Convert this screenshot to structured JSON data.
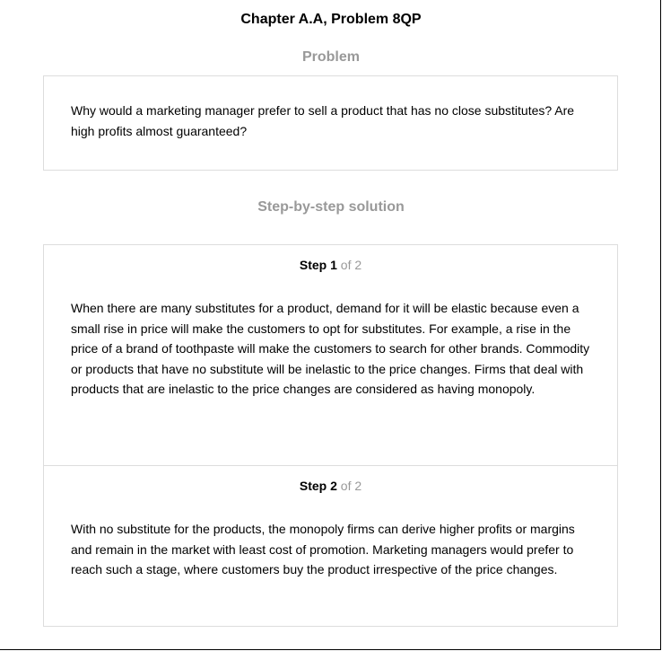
{
  "header": {
    "title": "Chapter A.A, Problem 8QP"
  },
  "problem": {
    "heading": "Problem",
    "text": "Why would a marketing manager prefer to sell a product that has no close substitutes? Are high profits almost guaranteed?"
  },
  "solution": {
    "heading": "Step-by-step solution",
    "step_word": "Step",
    "steps": [
      {
        "number": "1",
        "of_label": "of 2",
        "text": "When there are many substitutes for a product, demand for it will be elastic because even a small rise in price will make the customers to opt for substitutes. For example, a rise in the price of a brand of toothpaste will make the customers to search for other brands. Commodity or products that have no substitute will be inelastic to the price changes. Firms that deal with products that are inelastic to the price changes are considered as having monopoly."
      },
      {
        "number": "2",
        "of_label": "of 2",
        "text": "With no substitute for the products, the monopoly firms can derive higher profits or margins and remain in the market with least cost of promotion. Marketing managers would prefer to reach such a stage, where customers buy the product irrespective of the price changes."
      }
    ]
  },
  "colors": {
    "heading_gray": "#999999",
    "border_gray": "#dddddd",
    "text": "#000000"
  }
}
